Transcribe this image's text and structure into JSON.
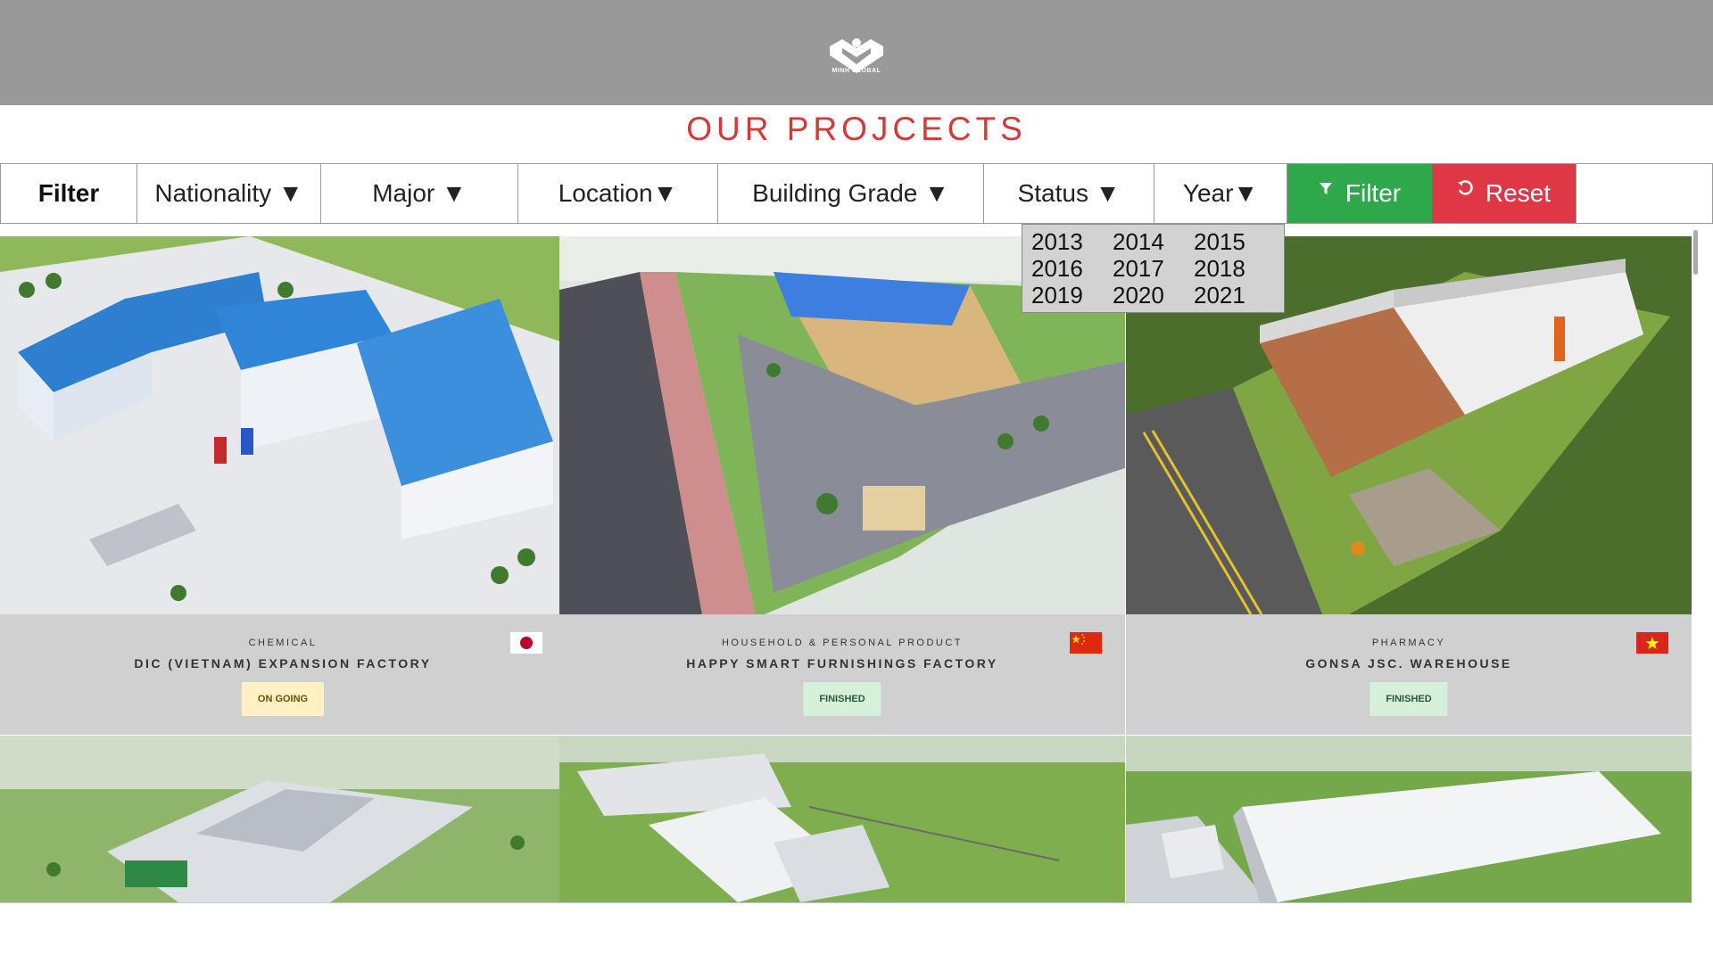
{
  "header": {
    "logo_text": "MINH GLOBAL"
  },
  "page": {
    "title": "OUR PROJCECTS"
  },
  "filter_bar": {
    "label": "Filter",
    "dropdowns": [
      "Nationality ▼",
      "Major ▼",
      "Location▼",
      "Building Grade ▼",
      "Status ▼",
      "Year▼"
    ],
    "filter_button": "Filter",
    "reset_button": "Reset",
    "filter_icon": "funnel-icon",
    "reset_icon": "undo-icon"
  },
  "year_dropdown": {
    "options": [
      "2013",
      "2014",
      "2015",
      "2016",
      "2017",
      "2018",
      "2019",
      "2020",
      "2021"
    ]
  },
  "projects": [
    {
      "category": "CHEMICAL",
      "name": "DIC (VIETNAM) EXPANSION FACTORY",
      "status": "ON GOING",
      "flag": "japan-flag-icon"
    },
    {
      "category": "HOUSEHOLD & PERSONAL PRODUCT",
      "name": "HAPPY SMART FURNISHINGS FACTORY",
      "status": "FINISHED",
      "flag": "china-flag-icon"
    },
    {
      "category": "PHARMACY",
      "name": "GONSA JSC. WAREHOUSE",
      "status": "FINISHED",
      "flag": "vietnam-flag-icon"
    }
  ],
  "colors": {
    "title": "#d23a3a",
    "filter_btn": "#2ea84a",
    "reset_btn": "#e03747",
    "header": "#999999"
  }
}
